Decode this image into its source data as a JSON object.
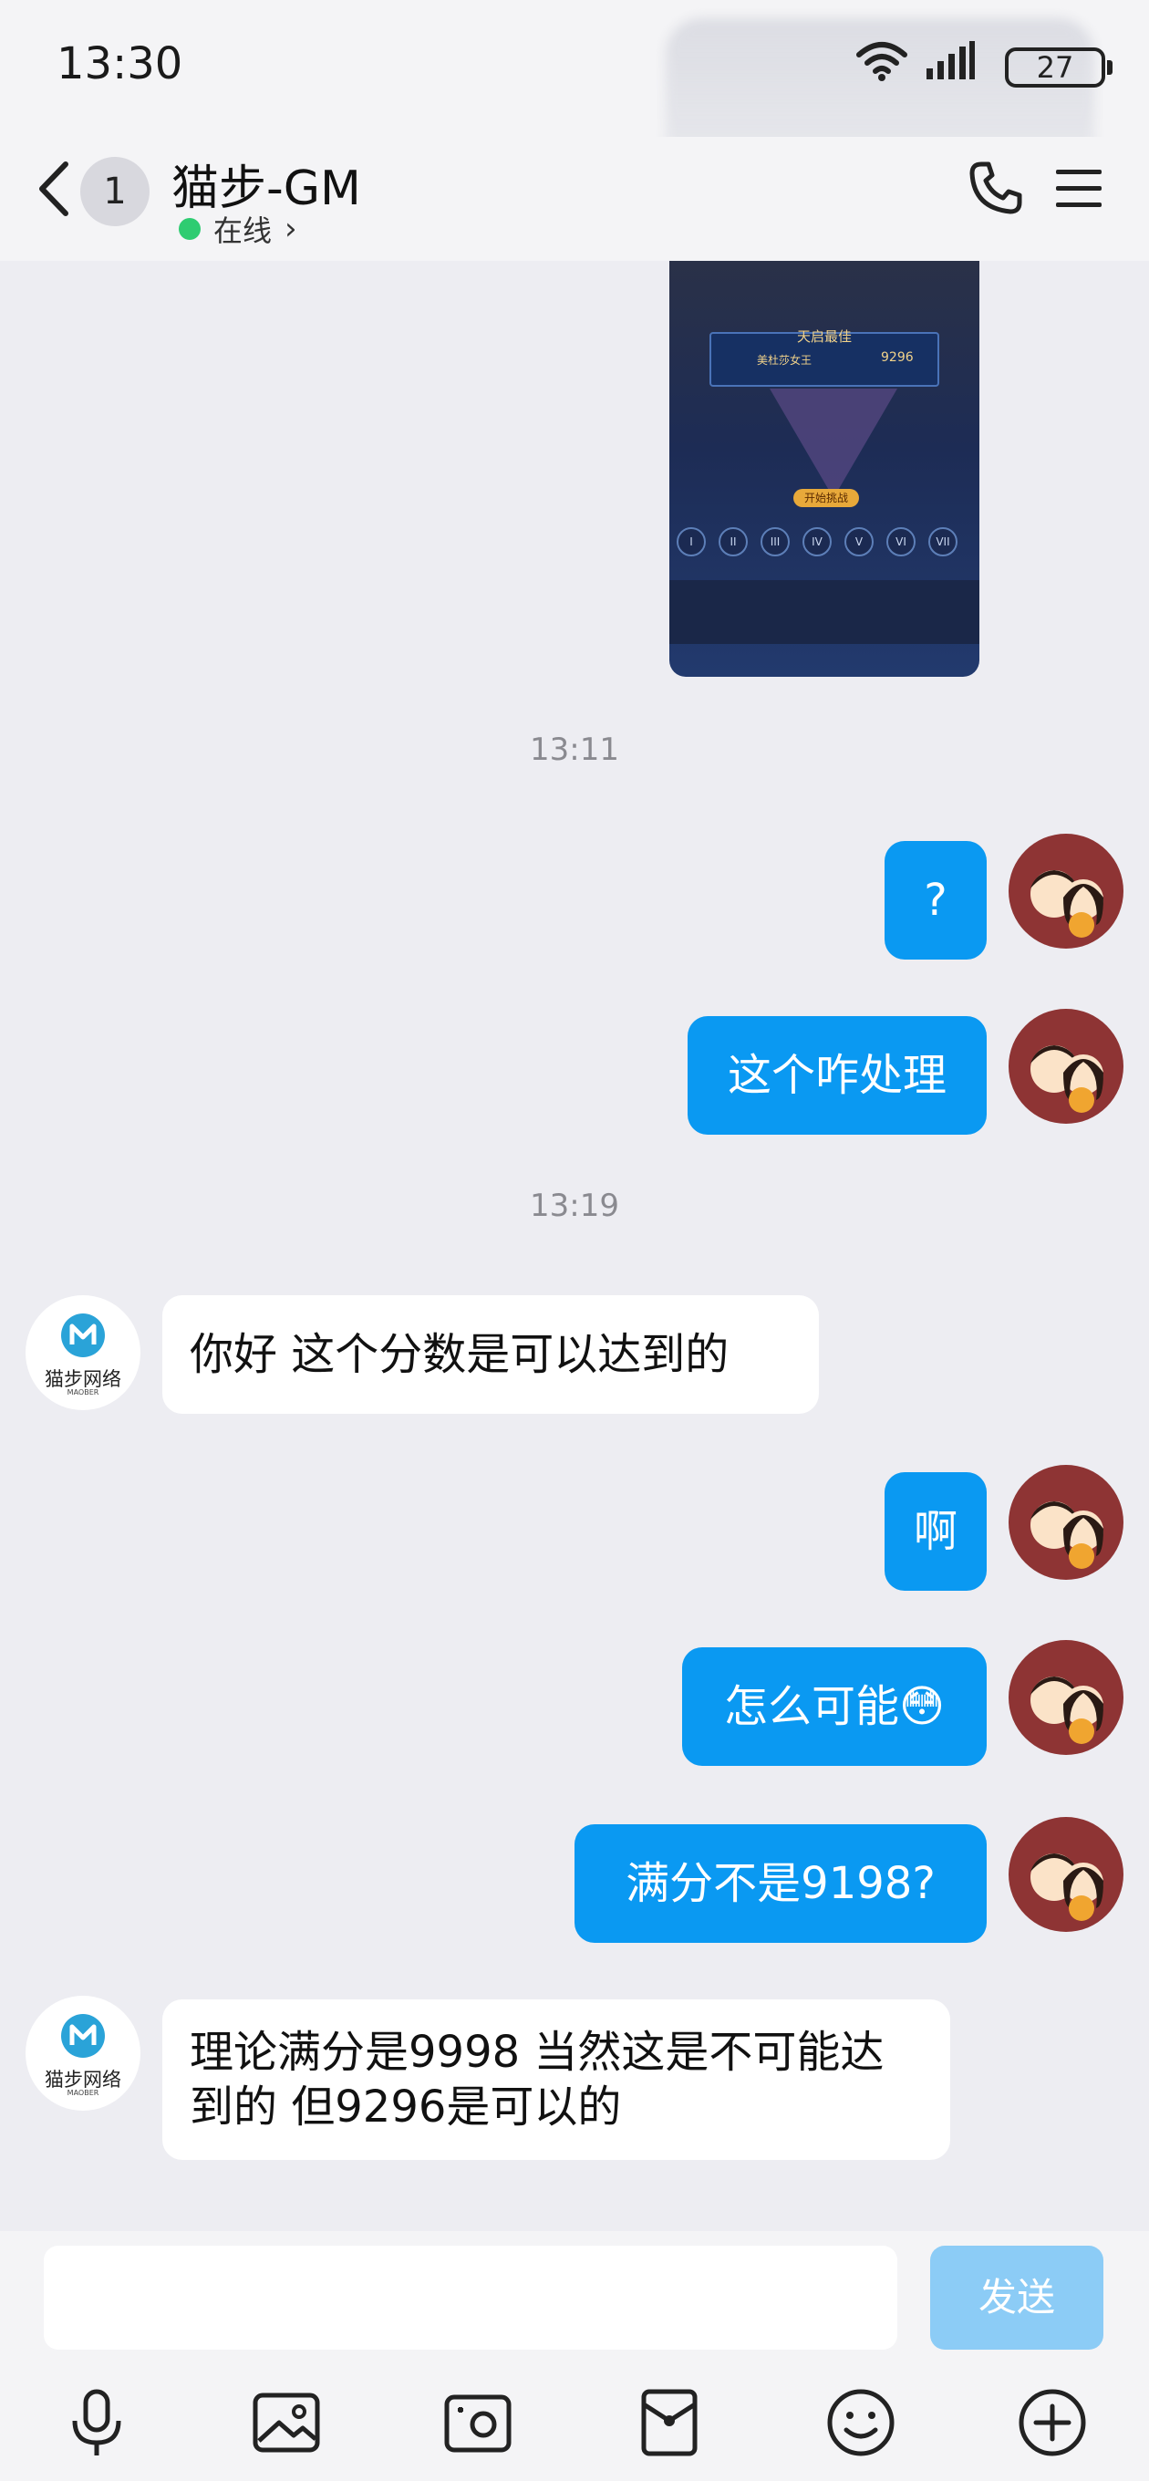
{
  "status_bar": {
    "time": "13:30",
    "battery": "27"
  },
  "header": {
    "back_badge": "1",
    "contact_name": "猫步-GM",
    "status": "在线",
    "status_chevron": "›"
  },
  "shared_image": {
    "panel_title": "天启最佳",
    "player_name": "美杜莎女王",
    "score": "9296",
    "start_label": "开始挑战",
    "levels": [
      "I",
      "II",
      "III",
      "IV",
      "V",
      "VI",
      "VII"
    ]
  },
  "messages": [
    {
      "type": "time",
      "text": "13:11"
    },
    {
      "type": "me",
      "text": "?"
    },
    {
      "type": "me",
      "text": "这个咋处理"
    },
    {
      "type": "time",
      "text": "13:19"
    },
    {
      "type": "gm",
      "text": "你好 这个分数是可以达到的"
    },
    {
      "type": "me",
      "text": "啊"
    },
    {
      "type": "me",
      "text": "怎么可能😳"
    },
    {
      "type": "me",
      "text": "满分不是9198?"
    },
    {
      "type": "gm",
      "text": "理论满分是9998  当然这是不可能达到的 但9296是可以的"
    }
  ],
  "gm_avatar": {
    "brand": "猫步网络",
    "sub": "MAOBER"
  },
  "input": {
    "value": "",
    "placeholder": "",
    "send_label": "发送"
  },
  "toolbar": [
    "microphone-icon",
    "image-icon",
    "camera-icon",
    "red-packet-icon",
    "emoji-icon",
    "plus-icon"
  ],
  "colors": {
    "bubble_me": "#0a99f2",
    "bubble_gm": "#ffffff",
    "send_disabled": "#8cccf6",
    "online": "#2ecc71",
    "avatar_me_bg": "#8e3434"
  }
}
